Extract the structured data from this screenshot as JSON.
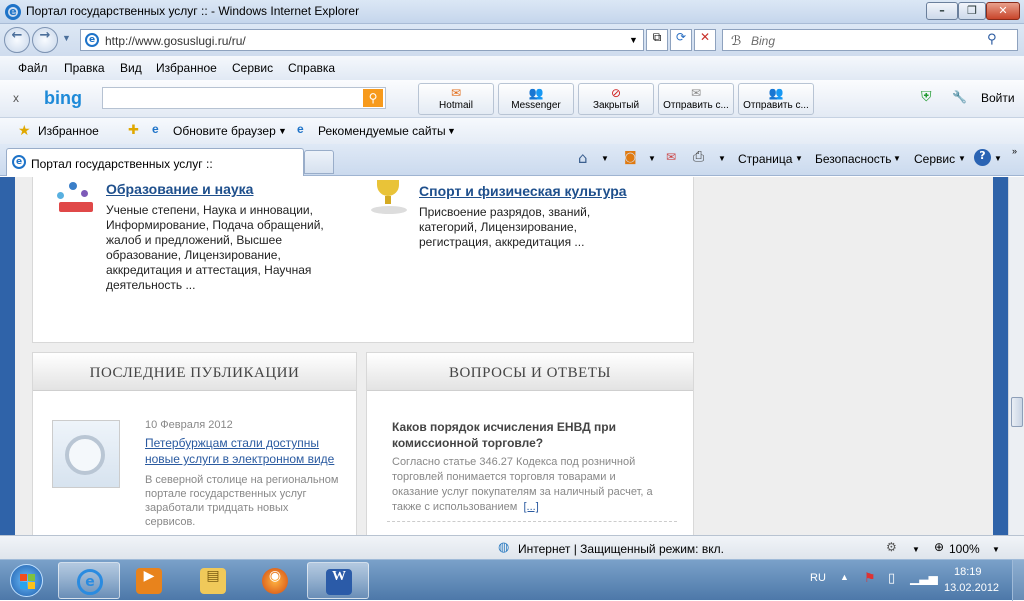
{
  "window": {
    "title": "Портал государственных услуг :: - Windows Internet Explorer",
    "min": "–",
    "max": "❐",
    "close": "✕"
  },
  "address": {
    "url": "http://www.gosuslugi.ru/ru/",
    "search_placeholder": "Bing"
  },
  "menu": [
    "Файл",
    "Правка",
    "Вид",
    "Избранное",
    "Сервис",
    "Справка"
  ],
  "bing": {
    "logo": "bing",
    "close": "x",
    "buttons": [
      "Hotmail",
      "Messenger",
      "Закрытый",
      "Отправить с...",
      "Отправить с..."
    ],
    "signin": "Войти"
  },
  "favorites": {
    "label": "Избранное",
    "items": [
      "Обновите браузер",
      "Рекомендуемые сайты"
    ]
  },
  "tabs": {
    "active": "Портал государственных услуг ::",
    "commands": [
      "Страница",
      "Безопасность",
      "Сервис"
    ]
  },
  "page": {
    "edu": {
      "title": "Образование и наука",
      "text": [
        "Ученые степени, Наука и инновации,",
        "Информирование, Подача обращений,",
        "жалоб и предложений, Высшее",
        "образование, Лицензирование,",
        "аккредитация и аттестация, Научная",
        "деятельность ..."
      ]
    },
    "sport": {
      "title": "Спорт и физическая культура",
      "text": [
        "Присвоение разрядов, званий,",
        "категорий, Лицензирование,",
        "регистрация, аккредитация ..."
      ]
    },
    "pubs": {
      "header": "ПОСЛЕДНИЕ ПУБЛИКАЦИИ",
      "date": "10 Февраля 2012",
      "link": [
        "Петербуржцам стали доступны",
        "новые услуги в электронном виде"
      ],
      "text": [
        "В северной столице на региональном",
        "портале государственных услуг",
        "заработали тридцать новых",
        "сервисов."
      ]
    },
    "faq": {
      "header": "ВОПРОСЫ И ОТВЕТЫ",
      "question": [
        "Каков порядок исчисления ЕНВД при",
        "комиссионной торговле?"
      ],
      "answer": [
        "Согласно статье 346.27 Кодекса под розничной",
        "торговлей понимается торговля товарами и",
        "оказание услуг покупателям за наличный расчет, а",
        "также с использованием"
      ],
      "more": "[...]"
    }
  },
  "status": {
    "zone": "Интернет | Защищенный режим: вкл.",
    "zoom": "100%"
  },
  "taskbar": {
    "lang": "RU",
    "time": "18:19",
    "date": "13.02.2012"
  },
  "colors": {
    "link": "#1e4f8c",
    "stripe": "#2f63a9",
    "taskbar": "#5a84b2"
  }
}
